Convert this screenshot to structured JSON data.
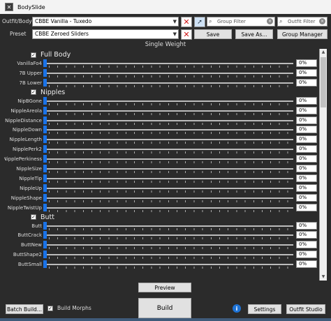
{
  "window": {
    "title": "BodySlide"
  },
  "outfit": {
    "label": "Outfit/Body",
    "value": "CBBE Vanilla - Tuxedo"
  },
  "preset": {
    "label": "Preset",
    "value": "CBBE Zeroed Sliders"
  },
  "filters": {
    "group_placeholder": "Group Filter",
    "outfit_placeholder": "Outfit Filter"
  },
  "buttons": {
    "save": "Save",
    "save_as": "Save As...",
    "group_manager": "Group Manager",
    "preview": "Preview",
    "build": "Build",
    "batch_build": "Batch Build...",
    "settings": "Settings",
    "outfit_studio": "Outfit Studio"
  },
  "build_morphs": {
    "label": "Build Morphs",
    "checked": true
  },
  "weight_label": "Single Weight",
  "groups": [
    {
      "name": "Full Body",
      "sliders": [
        {
          "name": "VanillaFo4",
          "value": "0%"
        },
        {
          "name": "7B Upper",
          "value": "0%"
        },
        {
          "name": "7B Lower",
          "value": "0%"
        }
      ]
    },
    {
      "name": "Nipples",
      "sliders": [
        {
          "name": "NipBGone",
          "value": "0%"
        },
        {
          "name": "NippleAreola",
          "value": "0%"
        },
        {
          "name": "NippleDistance",
          "value": "0%"
        },
        {
          "name": "NippleDown",
          "value": "0%"
        },
        {
          "name": "NippleLength",
          "value": "0%"
        },
        {
          "name": "NipplePerk2",
          "value": "0%"
        },
        {
          "name": "NipplePerkiness",
          "value": "0%"
        },
        {
          "name": "NippleSize",
          "value": "0%"
        },
        {
          "name": "NippleTip",
          "value": "0%"
        },
        {
          "name": "NippleUp",
          "value": "0%"
        },
        {
          "name": "NippleShape",
          "value": "0%"
        },
        {
          "name": "NippleTwistUp",
          "value": "0%"
        }
      ]
    },
    {
      "name": "Butt",
      "sliders": [
        {
          "name": "Butt",
          "value": "0%"
        },
        {
          "name": "ButtCrack",
          "value": "0%"
        },
        {
          "name": "ButtNew",
          "value": "0%"
        },
        {
          "name": "ButtShape2",
          "value": "0%"
        },
        {
          "name": "ButtSmall",
          "value": "0%"
        }
      ]
    }
  ],
  "icons": {
    "clear": "red-x-icon",
    "picker": "cursor-select-icon",
    "search": "search-icon",
    "info": "info-icon"
  },
  "colors": {
    "clear": "#d01818",
    "slider_thumb": "#1a73e8",
    "info": "#1e73d6"
  }
}
